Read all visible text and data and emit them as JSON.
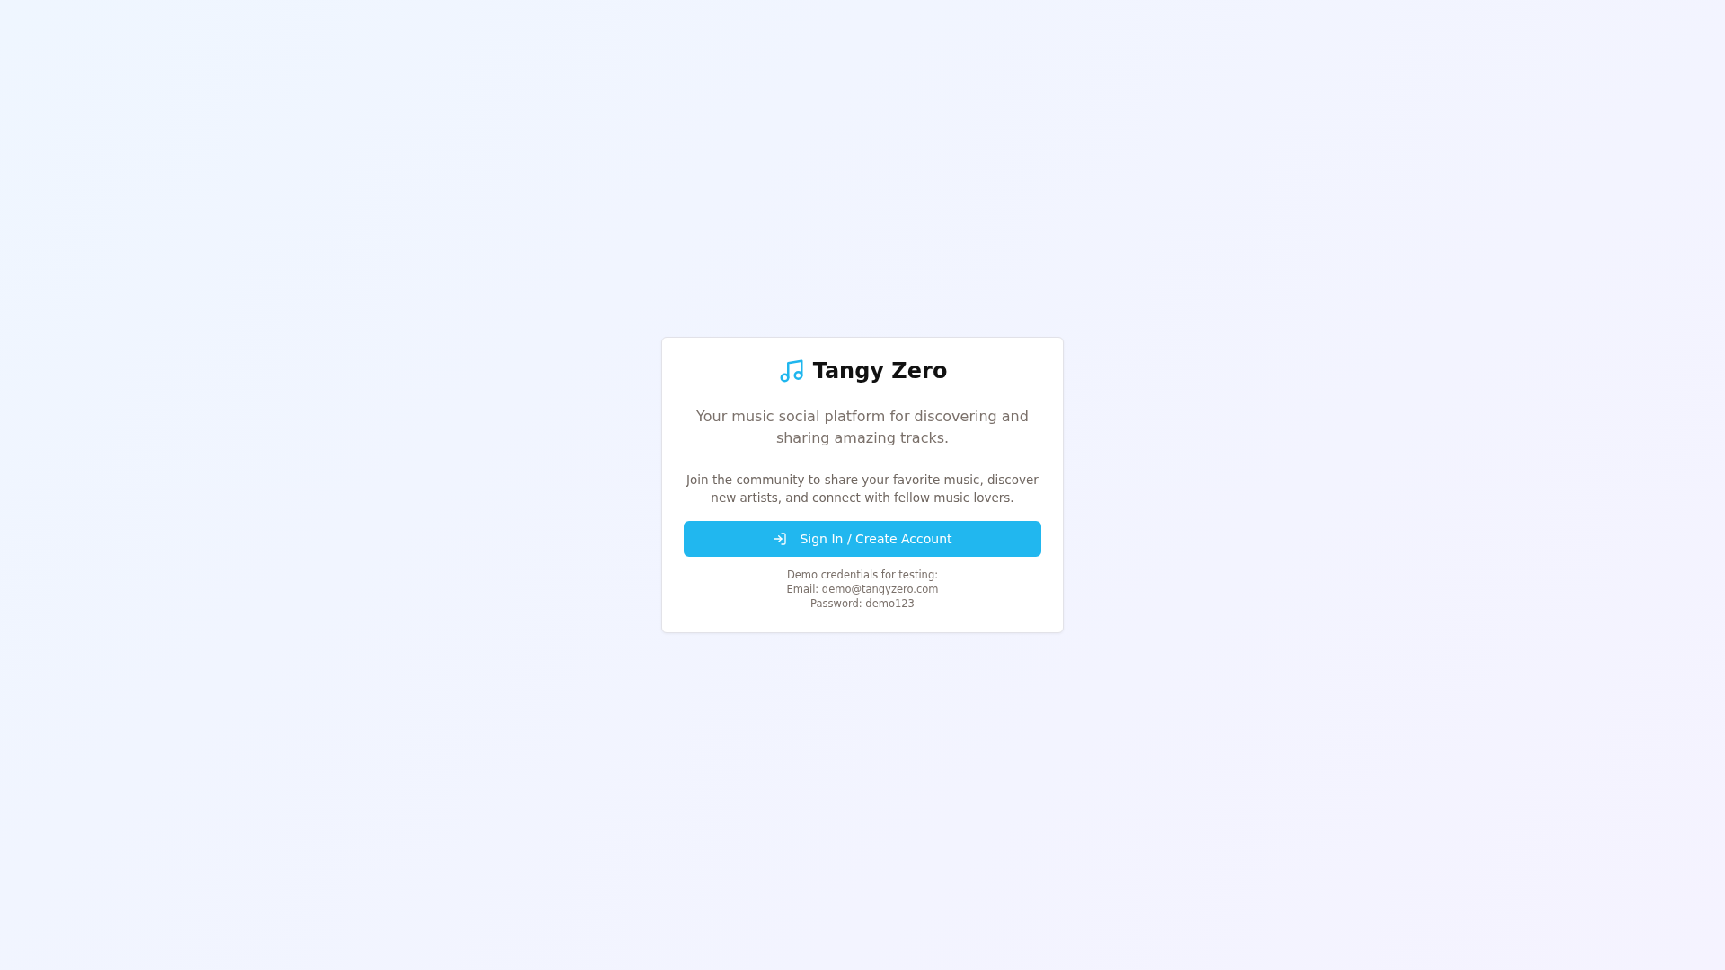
{
  "app": {
    "title": "Tangy Zero"
  },
  "tagline": "Your music social platform for discovering and sharing amazing tracks.",
  "description": "Join the community to share your favorite music, discover new artists, and connect with fellow music lovers.",
  "button": {
    "label": "Sign In / Create Account"
  },
  "demo_lines": [
    "Demo credentials for testing:",
    "Email: demo@tangyzero.com",
    "Password: demo123"
  ]
}
